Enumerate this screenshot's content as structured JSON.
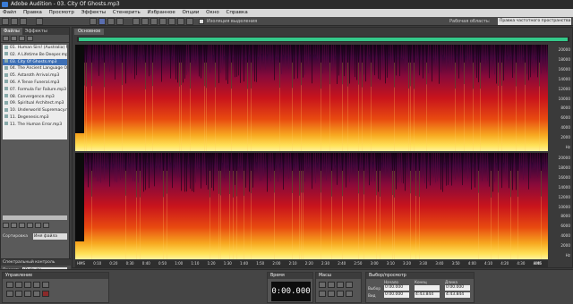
{
  "window": {
    "title": "Adobe Audition - 03. City Of Ghosts.mp3"
  },
  "menu": [
    "Файл",
    "Правка",
    "Просмотр",
    "Эффекты",
    "Стенерить",
    "Избранное",
    "Опции",
    "Окно",
    "Справка"
  ],
  "toolbar": {
    "loop_label": "Изоляция выделения",
    "workspace_label": "Рабочая область:",
    "workspace_value": "Правка частотного пространства"
  },
  "left_panel": {
    "tabs": [
      "Файлы",
      "Эффекты"
    ],
    "files": [
      "01. Human Sirs! (Australia) Memor",
      "02. A Lifetime Be Deeper.mp3",
      "03. City Of Ghosts.mp3",
      "04. The Ancient Language Of Dr",
      "05. Astaroth Arrival.mp3",
      "06. A Tense Funeral.mp3",
      "07. Formula For Failure.mp3",
      "08. Convergence.mp3",
      "09. Spiritual Architect.mp3",
      "10. Underworld Supremacy.mp3",
      "11. Degenesis.mp3",
      "11. The Human Error.mp3"
    ],
    "selected_index": 2,
    "sort_label": "Сортировка",
    "sort_value": "Имя файла"
  },
  "spectral_panel": {
    "title": "Спектральный контроль",
    "preset_label": "Пресет:",
    "preset_value": "(Default)",
    "bottom_label": "Области"
  },
  "editor": {
    "tab_label": "Основное",
    "hz_ticks_top": [
      "20000",
      "18000",
      "16000",
      "14000",
      "12000",
      "10000",
      "8000",
      "6000",
      "4000",
      "2000",
      "Hz"
    ],
    "hz_ticks_bottom": [
      "20000",
      "18000",
      "16000",
      "14000",
      "12000",
      "10000",
      "8000",
      "6000",
      "4000",
      "2000",
      "Hz"
    ],
    "timeline": [
      "HMS",
      "0:10",
      "0:20",
      "0:30",
      "0:40",
      "0:50",
      "1:00",
      "1:10",
      "1:20",
      "1:30",
      "1:40",
      "1:50",
      "2:00",
      "2:10",
      "2:20",
      "2:30",
      "2:40",
      "2:50",
      "3:00",
      "3:10",
      "3:20",
      "3:30",
      "3:40",
      "3:50",
      "4:00",
      "4:10",
      "4:20",
      "4:30",
      "4:40",
      "HMS"
    ]
  },
  "transport": {
    "title": "Управление"
  },
  "time": {
    "title": "Время",
    "value": "0:00.000"
  },
  "zoom": {
    "title": "Масш"
  },
  "selection": {
    "title": "Выбор/просмотр",
    "headers": [
      "Начало",
      "Конец",
      "Длина"
    ],
    "rows": [
      {
        "label": "Выбор",
        "start": "0:00.000",
        "end": "",
        "length": "0:00.000"
      },
      {
        "label": "Вид",
        "start": "0:00.000",
        "end": "4:43.844",
        "length": "4:43.844"
      }
    ]
  }
}
